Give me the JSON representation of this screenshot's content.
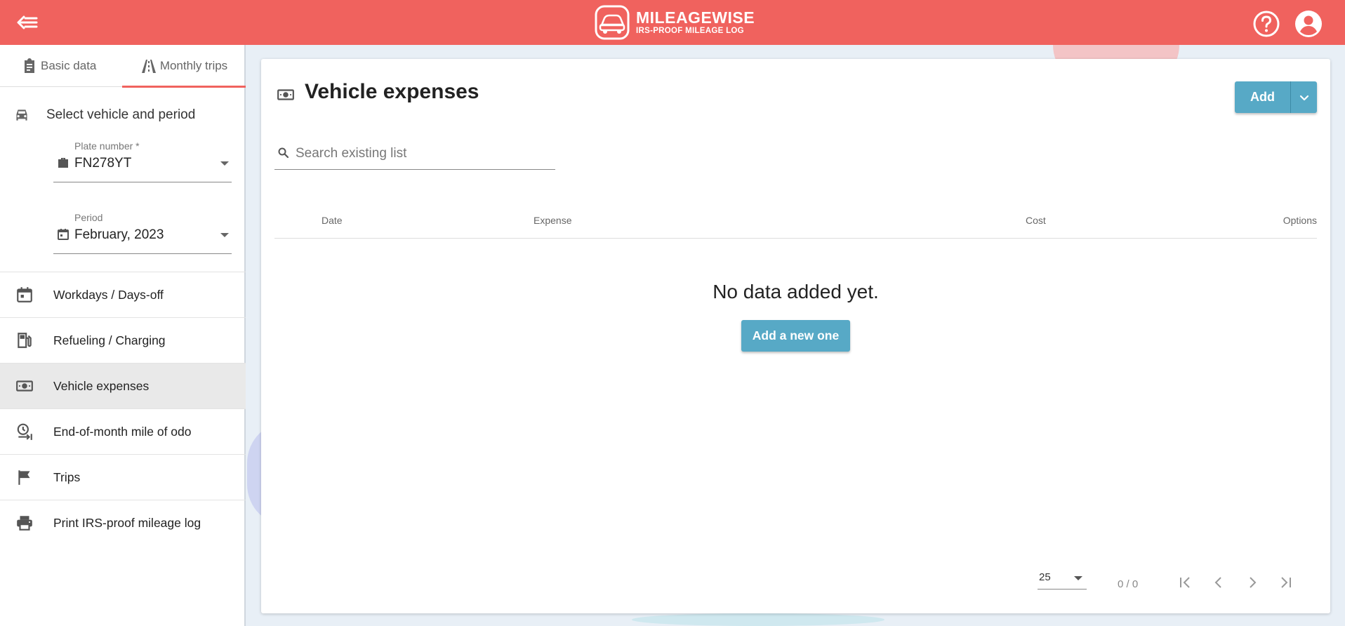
{
  "header": {
    "brand": "MILEAGEWISE",
    "tagline": "IRS-PROOF MILEAGE LOG",
    "color": "#f0625e"
  },
  "sidebar": {
    "tabs": [
      {
        "label": "Basic data",
        "icon": "clipboard-icon"
      },
      {
        "label": "Monthly trips",
        "icon": "road-icon",
        "active": true
      }
    ],
    "select_heading": "Select vehicle and period",
    "plate": {
      "label": "Plate number *",
      "value": "FN278YT"
    },
    "period": {
      "label": "Period",
      "value": "February, 2023"
    },
    "items": [
      {
        "label": "Workdays / Days-off",
        "icon": "calendar-icon"
      },
      {
        "label": "Refueling / Charging",
        "icon": "fuel-icon"
      },
      {
        "label": "Vehicle expenses",
        "icon": "money-icon",
        "active": true
      },
      {
        "label": "End-of-month mile of odo",
        "icon": "clock-icon"
      },
      {
        "label": "Trips",
        "icon": "flag-icon"
      },
      {
        "label": "Print IRS-proof mileage log",
        "icon": "print-icon"
      }
    ]
  },
  "main": {
    "title": "Vehicle expenses",
    "add_label": "Add",
    "search_placeholder": "Search existing list",
    "columns": {
      "date": "Date",
      "expense": "Expense",
      "cost": "Cost",
      "options": "Options"
    },
    "empty_text": "No data added yet.",
    "add_new_label": "Add a new one",
    "page_size": "25",
    "page_info": "0 / 0",
    "accent": "#57a9c6"
  }
}
